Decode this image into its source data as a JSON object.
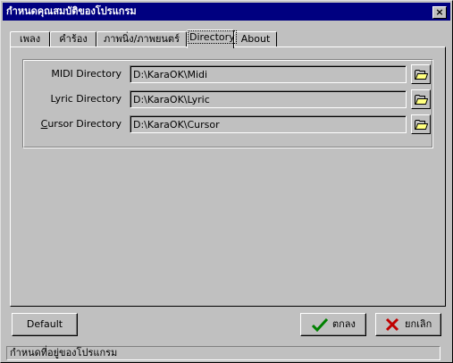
{
  "window": {
    "title": "กำหนดคุณสมบัติของโปรแกรม",
    "close_label": "×"
  },
  "tabs": [
    {
      "label": "เพลง"
    },
    {
      "label": "คำร้อง"
    },
    {
      "label": "ภาพนิ่ง/ภาพยนตร์"
    },
    {
      "label": "Directory",
      "active": true
    },
    {
      "label": "About"
    }
  ],
  "directories": {
    "midi": {
      "label": "MIDI Directory",
      "value": "D:\\KaraOK\\Midi"
    },
    "lyric": {
      "label": "Lyric Directory",
      "value": "D:\\KaraOK\\Lyric"
    },
    "cursor": {
      "label_prefix": "C",
      "label_rest": "ursor Directory",
      "value": "D:\\KaraOK\\Cursor"
    }
  },
  "buttons": {
    "default_label": "Default",
    "ok_label": "ตกลง",
    "cancel_label": "ยกเลิก"
  },
  "status": {
    "text": "กำหนดที่อยู่ของโปรแกรม"
  },
  "colors": {
    "titlebar": "#000080",
    "ok_check": "#008000",
    "cancel_x": "#c00000",
    "folder": "#ffff80"
  }
}
